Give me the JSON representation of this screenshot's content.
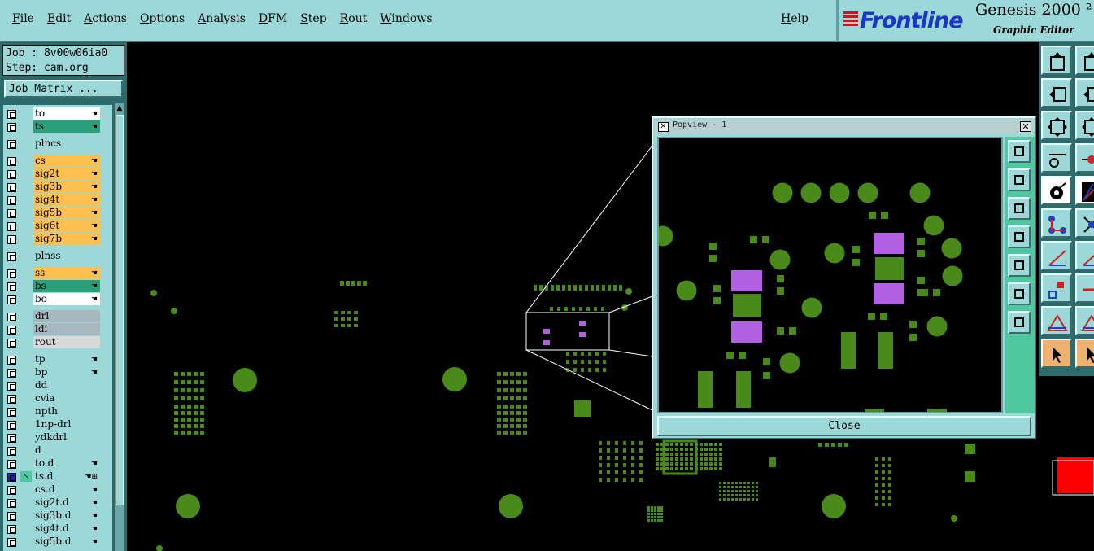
{
  "menu": {
    "items": [
      "File",
      "Edit",
      "Actions",
      "Options",
      "Analysis",
      "DFM",
      "Step",
      "Rout",
      "Windows"
    ],
    "help": "Help"
  },
  "brand": {
    "logo": "Frontline",
    "title": "Genesis 2000 ²",
    "subtitle": "Graphic Editor"
  },
  "job": {
    "job_line": "Job : 8v00w06ia0",
    "step_line": "Step: cam.org",
    "matrix_button": "Job Matrix ..."
  },
  "layers": [
    {
      "name": "to",
      "color": "#ffffff",
      "hand": true
    },
    {
      "name": "ts",
      "color": "#2aa07a",
      "hand": true
    },
    {
      "name": "plncs",
      "color": "#9cd8d8",
      "hand": false,
      "gap": true
    },
    {
      "name": "cs",
      "color": "#ffc050",
      "hand": true,
      "gap": true
    },
    {
      "name": "sig2t",
      "color": "#ffc050",
      "hand": true
    },
    {
      "name": "sig3b",
      "color": "#ffc050",
      "hand": true
    },
    {
      "name": "sig4t",
      "color": "#ffc050",
      "hand": true
    },
    {
      "name": "sig5b",
      "color": "#ffc050",
      "hand": true
    },
    {
      "name": "sig6t",
      "color": "#ffc050",
      "hand": true
    },
    {
      "name": "sig7b",
      "color": "#ffc050",
      "hand": true
    },
    {
      "name": "plnss",
      "color": "#9cd8d8",
      "hand": false,
      "gap": true
    },
    {
      "name": "ss",
      "color": "#ffc050",
      "hand": true,
      "gap": true
    },
    {
      "name": "bs",
      "color": "#2aa07a",
      "hand": true
    },
    {
      "name": "bo",
      "color": "#ffffff",
      "hand": true
    },
    {
      "name": "drl",
      "color": "#a8b8c0",
      "hand": false,
      "gap": true
    },
    {
      "name": "ldi",
      "color": "#a8b8c0",
      "hand": false
    },
    {
      "name": "rout",
      "color": "#d8d8d8",
      "hand": false
    },
    {
      "name": "tp",
      "color": "#9cd8d8",
      "hand": true,
      "gap": true
    },
    {
      "name": "bp",
      "color": "#9cd8d8",
      "hand": true
    },
    {
      "name": "dd",
      "color": "#9cd8d8",
      "hand": false
    },
    {
      "name": "cvia",
      "color": "#9cd8d8",
      "hand": false
    },
    {
      "name": "npth",
      "color": "#9cd8d8",
      "hand": false
    },
    {
      "name": "1np-drl",
      "color": "#9cd8d8",
      "hand": false
    },
    {
      "name": "ydkdrl",
      "color": "#9cd8d8",
      "hand": false
    },
    {
      "name": "d",
      "color": "#9cd8d8",
      "hand": false
    },
    {
      "name": "to.d",
      "color": "#9cd8d8",
      "hand": true
    },
    {
      "name": "ts.d",
      "color": "#9cd8d8",
      "hand": true,
      "active": true
    },
    {
      "name": "cs.d",
      "color": "#9cd8d8",
      "hand": true
    },
    {
      "name": "sig2t.d",
      "color": "#9cd8d8",
      "hand": true
    },
    {
      "name": "sig3b.d",
      "color": "#9cd8d8",
      "hand": true
    },
    {
      "name": "sig4t.d",
      "color": "#9cd8d8",
      "hand": true
    },
    {
      "name": "sig5b.d",
      "color": "#9cd8d8",
      "hand": true
    }
  ],
  "popview": {
    "title": "Popview - 1",
    "close_label": "Close"
  },
  "colors": {
    "pad_green": "#4a8a1a",
    "pad_purple": "#b060e0",
    "ui_cyan": "#9cd8d8",
    "frame_teal": "#2b6b6b"
  }
}
